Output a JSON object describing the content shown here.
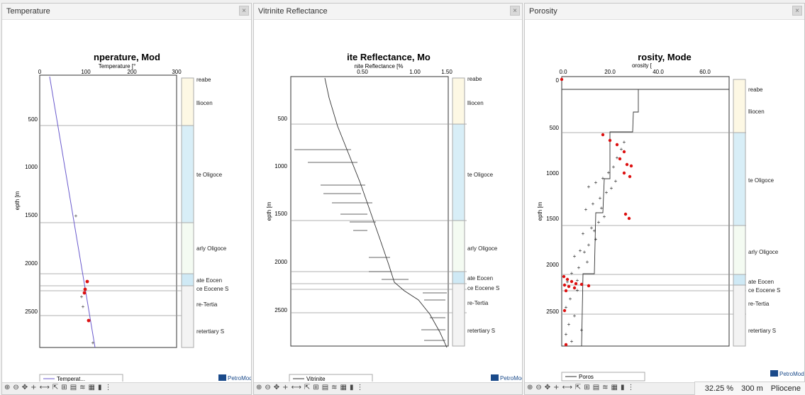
{
  "panels": [
    {
      "title": "Temperature",
      "plot_title": "nperature, Mod",
      "x_axis_label": "Temperature [°",
      "x_ticks": [
        "0",
        "100",
        "200",
        "300"
      ],
      "y_axis_label": "epth [m",
      "y_ticks": [
        "500",
        "1000",
        "1500",
        "2000",
        "2500"
      ],
      "legend": "Temperat...",
      "logo": "PetroMod",
      "strat_labels": [
        "reabe",
        "lliocen",
        "te Oligoce",
        "arly Oligoce",
        "ate Eocen",
        "ce Eocene S",
        "re-Tertia",
        "retertiary S"
      ],
      "close_icon": "×"
    },
    {
      "title": "Vitrinite Reflectance",
      "plot_title": "ite Reflectance, Mo",
      "x_axis_label": "nite Reflectance [%",
      "x_ticks": [
        "0.50",
        "1.00",
        "1.50"
      ],
      "y_axis_label": "epth [m",
      "y_ticks": [
        "500",
        "1000",
        "1500",
        "2000",
        "2500"
      ],
      "legend": "Vitrinite",
      "logo": "PetroMod",
      "strat_labels": [
        "reabe",
        "lliocen",
        "te Oligoce",
        "arly Oligoce",
        "ate Eocen",
        "ce Eocene S",
        "re-Tertia",
        "retertiary S"
      ],
      "close_icon": "×"
    },
    {
      "title": "Porosity",
      "plot_title": "rosity, Mode",
      "x_axis_label": "orosity [",
      "x_ticks": [
        "0.0",
        "20.0",
        "40.0",
        "60.0"
      ],
      "y_axis_label": "epth [m",
      "y_ticks": [
        "0",
        "500",
        "1000",
        "1500",
        "2000",
        "2500"
      ],
      "legend": "Poros",
      "logo": "PetroMod",
      "strat_labels": [
        "reabe",
        "lliocen",
        "te Oligoce",
        "arly Oligoce",
        "ate Eocen",
        "ce Eocene S",
        "re-Tertia",
        "retertiary S"
      ],
      "close_icon": "×"
    }
  ],
  "toolbar_icons": [
    "zoom-in-icon",
    "zoom-out-icon",
    "pan-icon",
    "crosshair-icon",
    "measure-icon",
    "select-icon",
    "axis-icon",
    "grid-icon",
    "legend-icon",
    "color-icon",
    "layers-icon",
    "table-icon"
  ],
  "toolbar_glyphs": [
    "⊕",
    "⊖",
    "✥",
    "+",
    "⟷",
    "⇱",
    "⊞",
    "▤",
    "≋",
    "▦",
    "▮",
    "⋮"
  ],
  "status": {
    "zoom": "32.25 %",
    "depth": "300 m",
    "layer": "Pliocene"
  },
  "colors": {
    "temperature_line": "#6a5acd",
    "data_red": "#dd1111",
    "oligocene_fill": "#d8eef7",
    "pliocene_fill": "#fdf8e4"
  }
}
